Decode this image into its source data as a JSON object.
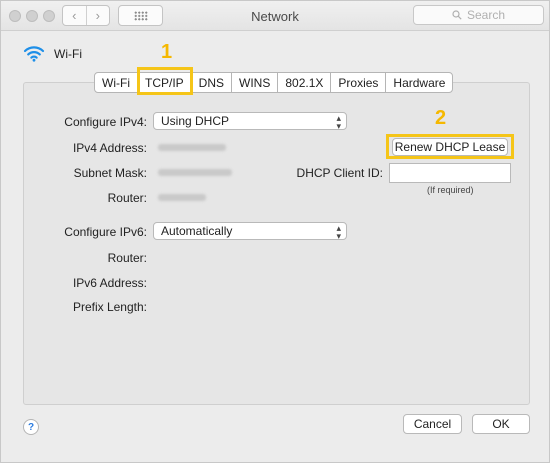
{
  "window": {
    "title": "Network"
  },
  "titlebar": {
    "back_glyph": "‹",
    "forward_glyph": "›",
    "search_placeholder": "Search"
  },
  "header": {
    "interface_label": "Wi-Fi"
  },
  "tabs": [
    {
      "label": "Wi-Fi",
      "active": false
    },
    {
      "label": "TCP/IP",
      "active": true
    },
    {
      "label": "DNS",
      "active": false
    },
    {
      "label": "WINS",
      "active": false
    },
    {
      "label": "802.1X",
      "active": false
    },
    {
      "label": "Proxies",
      "active": false
    },
    {
      "label": "Hardware",
      "active": false
    }
  ],
  "callouts": {
    "first": "1",
    "second": "2",
    "color": "#f5c518"
  },
  "ipv4": {
    "configure_label": "Configure IPv4:",
    "configure_value": "Using DHCP",
    "address_label": "IPv4 Address:",
    "subnet_label": "Subnet Mask:",
    "router_label": "Router:",
    "renew_button": "Renew DHCP Lease",
    "client_id_label": "DHCP Client ID:",
    "client_id_value": "",
    "client_id_hint": "(If required)"
  },
  "ipv6": {
    "configure_label": "Configure IPv6:",
    "configure_value": "Automatically",
    "router_label": "Router:",
    "address_label": "IPv6 Address:",
    "prefix_label": "Prefix Length:"
  },
  "footer": {
    "help_glyph": "?",
    "cancel_label": "Cancel",
    "ok_label": "OK"
  }
}
